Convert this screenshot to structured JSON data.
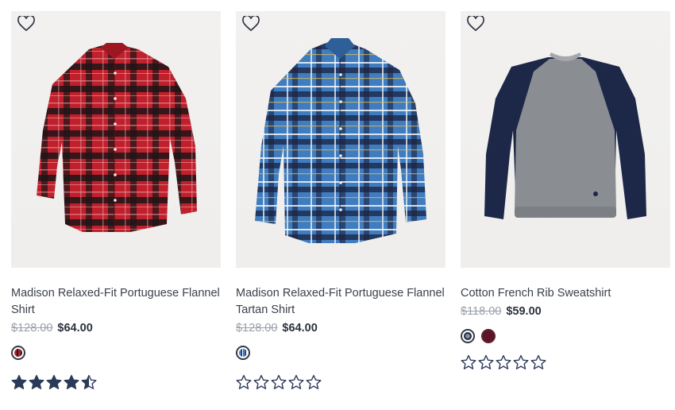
{
  "products": [
    {
      "name": "Madison Relaxed-Fit Portuguese Flannel Shirt",
      "original_price": "$128.00",
      "sale_price": "$64.00",
      "rating": 4.5,
      "swatches": [
        {
          "color": "#b8222e",
          "pattern": "red-plaid",
          "selected": true
        }
      ]
    },
    {
      "name": "Madison Relaxed-Fit Portuguese Flannel Tartan Shirt",
      "original_price": "$128.00",
      "sale_price": "$64.00",
      "rating": 0,
      "swatches": [
        {
          "color": "#3f78b8",
          "pattern": "blue-plaid",
          "selected": true
        }
      ]
    },
    {
      "name": "Cotton French Rib Sweatshirt",
      "original_price": "$118.00",
      "sale_price": "$59.00",
      "rating": 0,
      "swatches": [
        {
          "color": "#8a8d92",
          "pattern": "grey-navy",
          "selected": true
        },
        {
          "color": "#5a1624",
          "pattern": "burgundy",
          "selected": false
        }
      ]
    }
  ],
  "icons": {
    "wishlist": "heart-outline-icon",
    "star": "star-icon"
  },
  "colors": {
    "text": "#3a3f4a",
    "sale_price": "#2c3240",
    "original_price": "#9aa0a8",
    "star": "#2c3a5a"
  }
}
